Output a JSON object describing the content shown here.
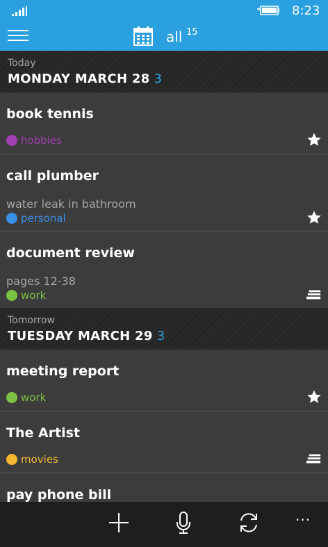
{
  "status": {
    "time": "8:23"
  },
  "header": {
    "title": "all",
    "count": "15"
  },
  "days": [
    {
      "sub": "Today",
      "title": "MONDAY MARCH 28",
      "count": "3",
      "tasks": [
        {
          "title": "book tennis",
          "note": "",
          "tag": "hobbies",
          "tag_color": "#a040b0",
          "icon": "star-icon"
        },
        {
          "title": "call plumber",
          "note": "water leak in bathroom",
          "tag": "personal",
          "tag_color": "#3a8ee6",
          "icon": "star-icon"
        },
        {
          "title": "document review",
          "note": "pages 12-38",
          "tag": "work",
          "tag_color": "#7cc242",
          "icon": "stack-icon"
        }
      ]
    },
    {
      "sub": "Tomorrow",
      "title": "TUESDAY MARCH 29",
      "count": "3",
      "tasks": [
        {
          "title": "meeting report",
          "note": "",
          "tag": "work",
          "tag_color": "#7cc242",
          "icon": "star-icon"
        },
        {
          "title": "The Artist",
          "note": "",
          "tag": "movies",
          "tag_color": "#f5b830",
          "icon": "stack-icon"
        },
        {
          "title": "pay phone bill",
          "note": "",
          "tag": "",
          "tag_color": "",
          "icon": ""
        }
      ]
    }
  ],
  "toolbar": {
    "add": "add-icon",
    "voice": "microphone-icon",
    "sync": "sync-icon",
    "more": "···"
  }
}
